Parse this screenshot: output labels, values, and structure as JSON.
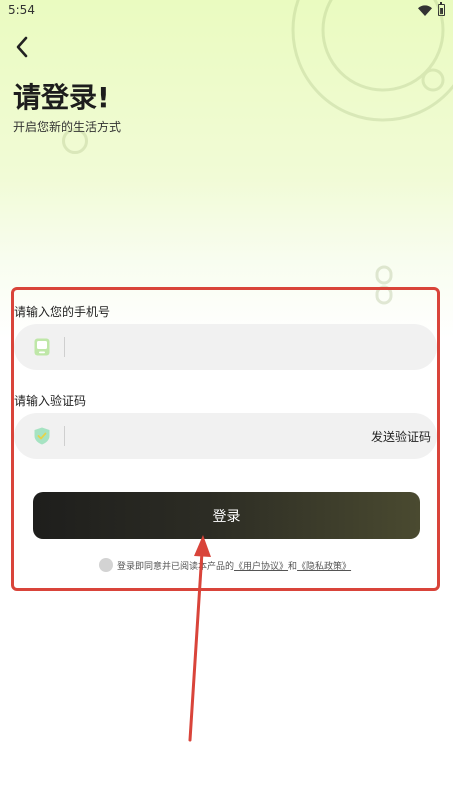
{
  "status_bar": {
    "time": "5:54"
  },
  "header": {
    "title": "请登录!",
    "subtitle": "开启您新的生活方式"
  },
  "form": {
    "phone_label": "请输入您的手机号",
    "phone_value": "",
    "code_label": "请输入验证码",
    "code_value": "",
    "send_code": "发送验证码",
    "login_button": "登录"
  },
  "agreement": {
    "prefix": "登录即同意并已阅读本产品的",
    "user_agreement": "《用户协议》",
    "conjunction": "和",
    "privacy_policy": "《隐私政策》"
  },
  "colors": {
    "annotation_red": "#d9443a",
    "button_dark": "#1e1e1c",
    "button_olive": "#4a4a30",
    "background_green": "#eafbc0"
  },
  "icons": {
    "back": "back-chevron-icon",
    "phone": "phone-icon",
    "shield": "shield-check-icon",
    "wifi": "wifi-icon",
    "battery": "battery-icon"
  }
}
